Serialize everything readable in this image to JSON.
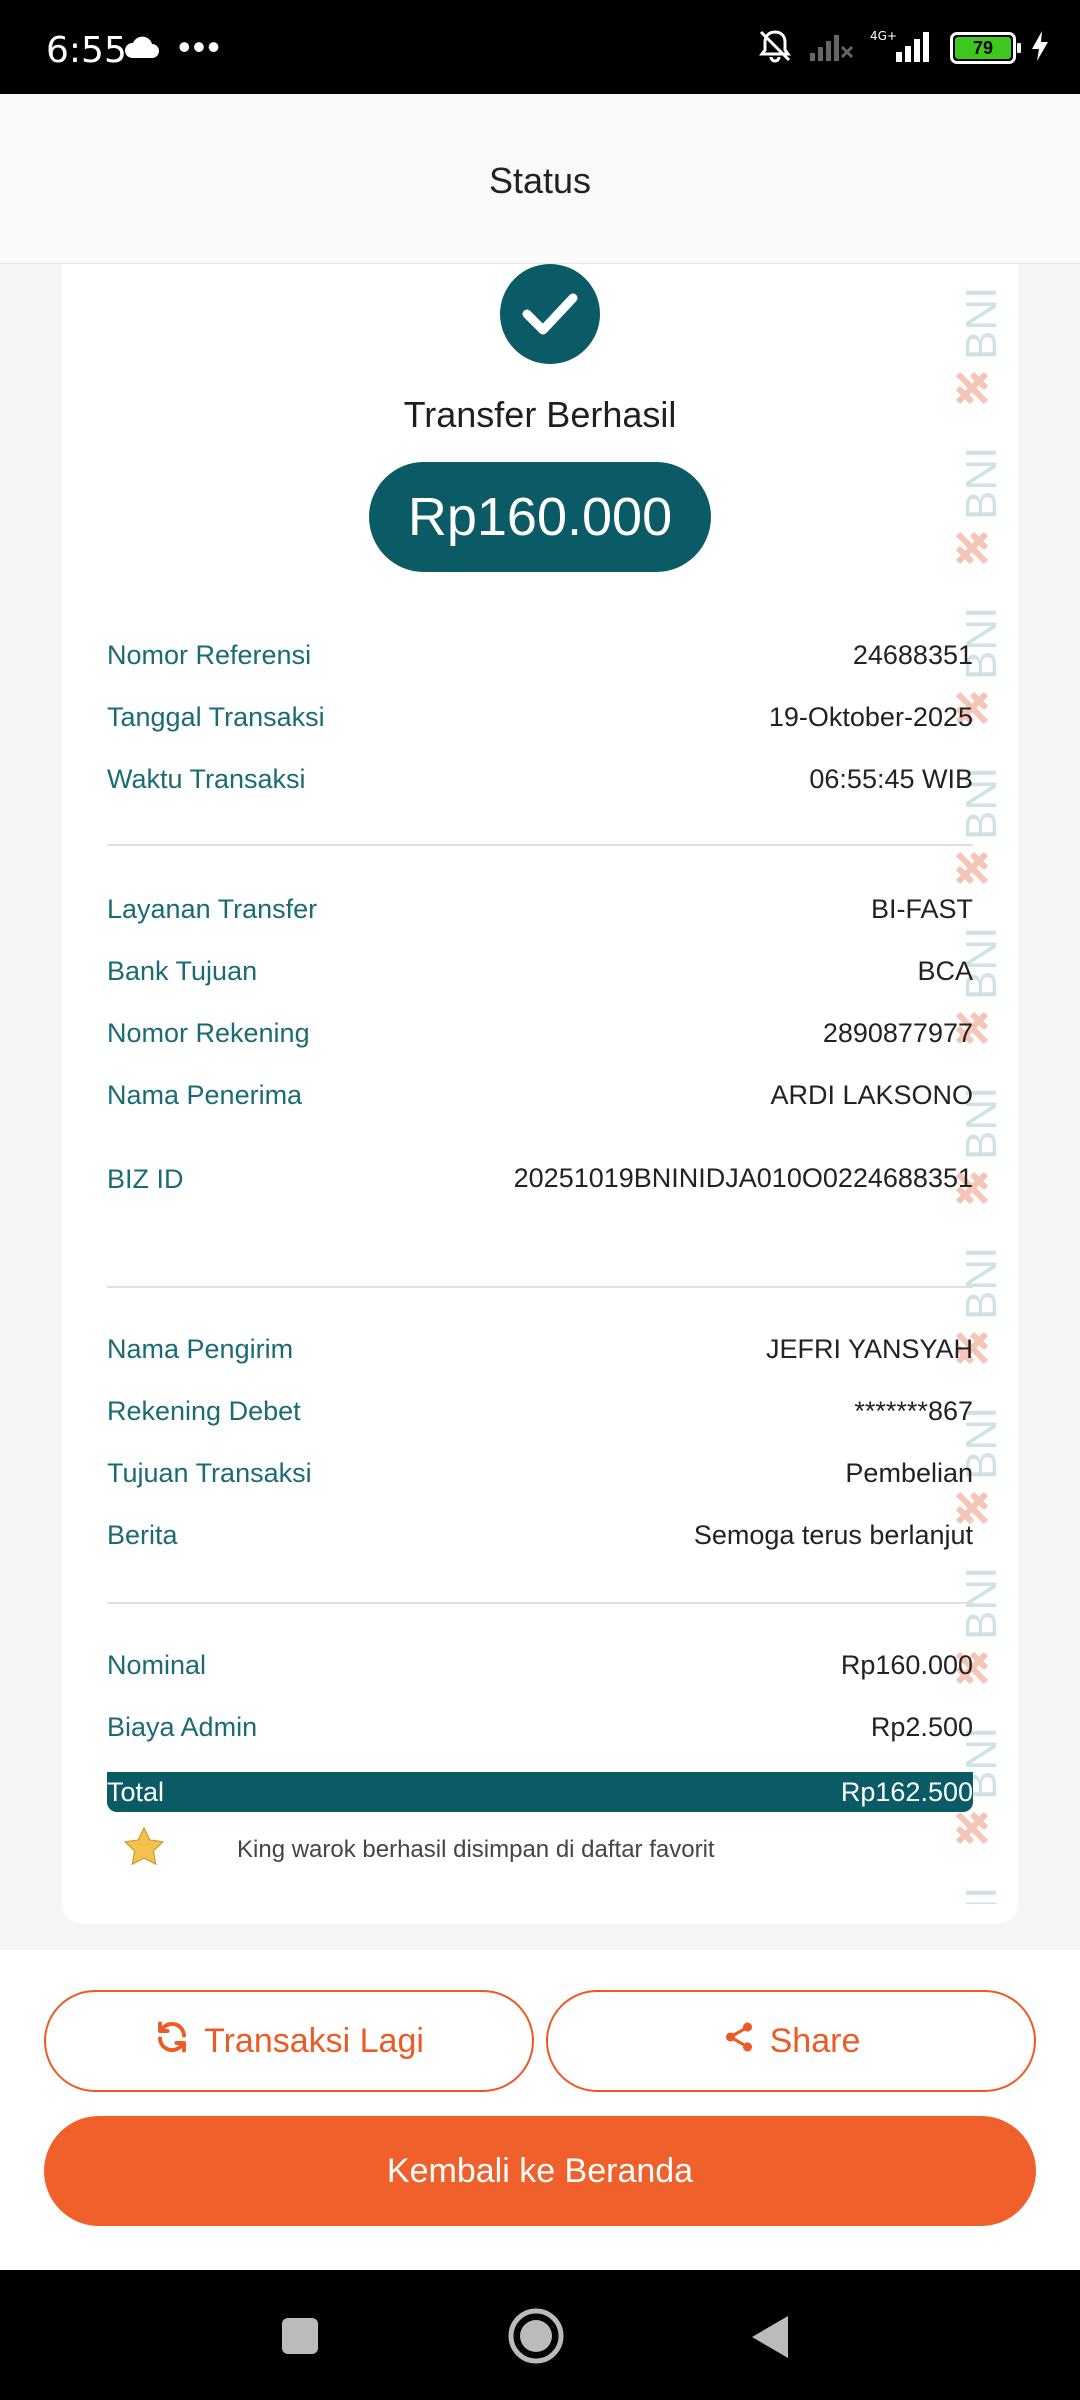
{
  "status_bar": {
    "time": "6:55",
    "dots": "•••",
    "network": "4G+",
    "battery": "79"
  },
  "header": {
    "title": "Status"
  },
  "receipt": {
    "title": "Transfer Berhasil",
    "amount": "Rp160.000",
    "watermark_text": "BNI",
    "section1": [
      {
        "label": "Nomor Referensi",
        "value": "24688351"
      },
      {
        "label": "Tanggal Transaksi",
        "value": "19-Oktober-2025"
      },
      {
        "label": "Waktu Transaksi",
        "value": "06:55:45 WIB"
      }
    ],
    "section2": [
      {
        "label": "Layanan Transfer",
        "value": "BI-FAST"
      },
      {
        "label": "Bank Tujuan",
        "value": "BCA"
      },
      {
        "label": "Nomor Rekening",
        "value": "2890877977"
      },
      {
        "label": "Nama Penerima",
        "value": "ARDI LAKSONO"
      },
      {
        "label": "BIZ ID",
        "value": "20251019BNINIDJA010O0224688351"
      }
    ],
    "section3": [
      {
        "label": "Nama Pengirim",
        "value": "JEFRI YANSYAH"
      },
      {
        "label": "Rekening Debet",
        "value": "*******867"
      },
      {
        "label": "Tujuan Transaksi",
        "value": "Pembelian"
      },
      {
        "label": "Berita",
        "value": "Semoga terus berlanjut"
      }
    ],
    "section4": [
      {
        "label": "Nominal",
        "value": "Rp160.000"
      },
      {
        "label": "Biaya Admin",
        "value": "Rp2.500"
      }
    ],
    "total": {
      "label": "Total",
      "value": "Rp162.500"
    },
    "favorite_message": "King warok berhasil disimpan di daftar favorit"
  },
  "actions": {
    "repeat_label": "Transaksi Lagi",
    "share_label": "Share",
    "home_label": "Kembali ke Beranda"
  },
  "colors": {
    "primary_teal": "#0a5b66",
    "accent_orange": "#f0602b",
    "label_teal": "#1b6b74",
    "star": "#f2c14e"
  }
}
